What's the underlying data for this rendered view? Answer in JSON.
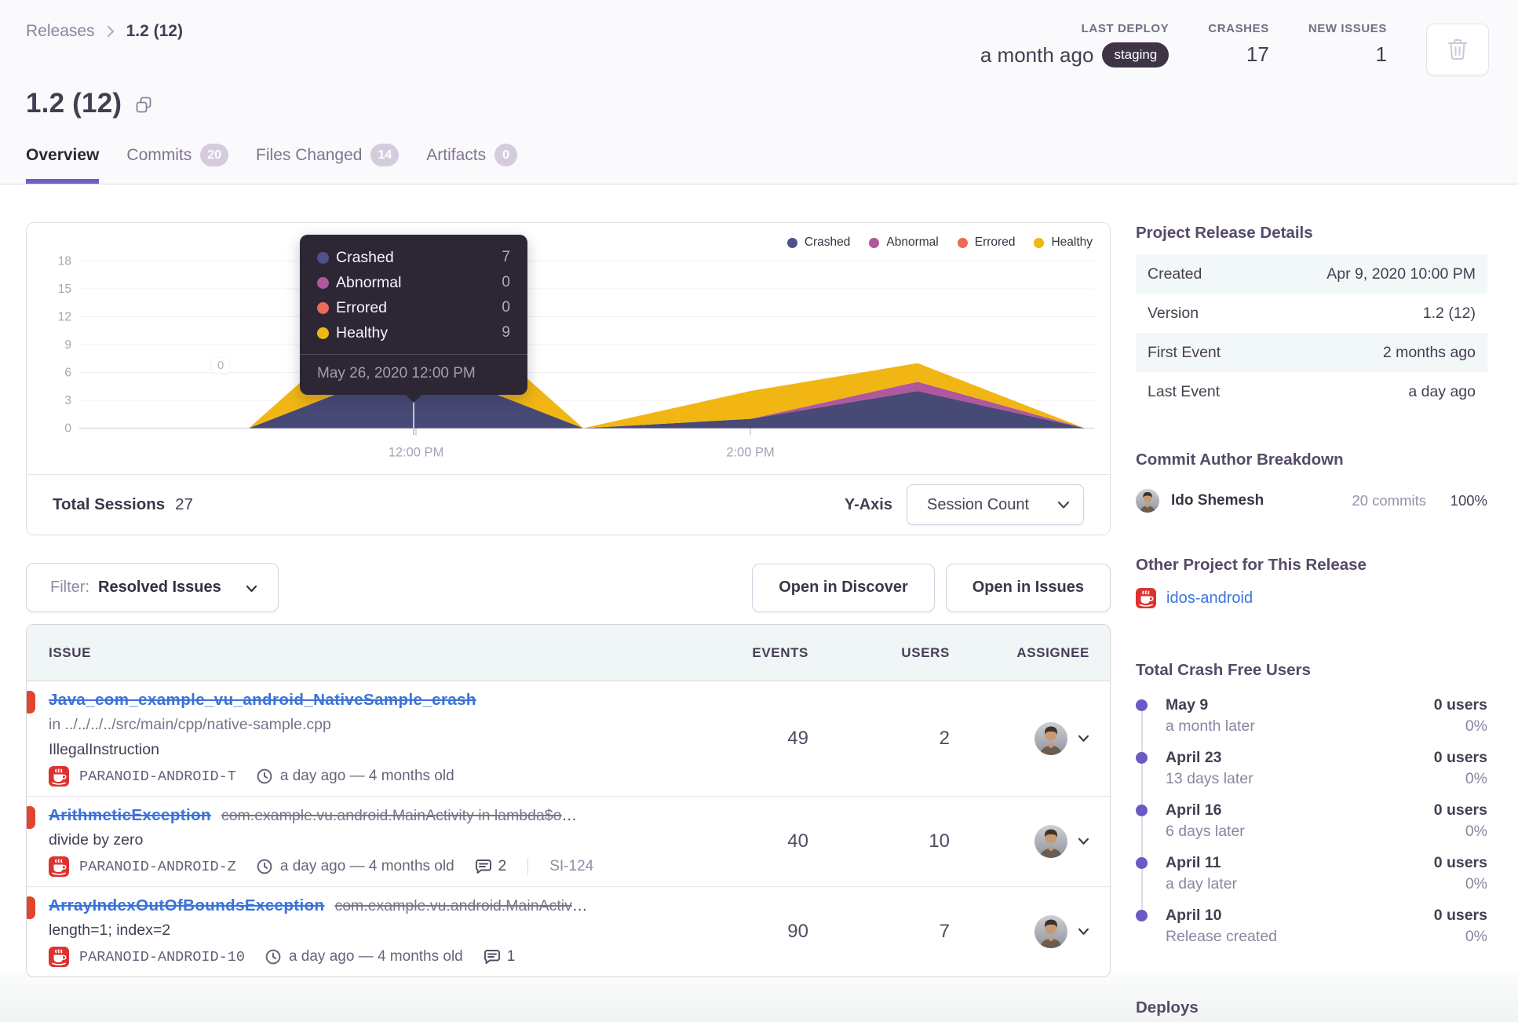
{
  "header": {
    "breadcrumb": {
      "root": "Releases",
      "current": "1.2 (12)"
    },
    "title": "1.2 (12)",
    "stats": [
      {
        "label": "LAST DEPLOY",
        "value": "a month ago",
        "badge": "staging"
      },
      {
        "label": "CRASHES",
        "value": "17"
      },
      {
        "label": "NEW ISSUES",
        "value": "1"
      }
    ],
    "tabs": [
      {
        "label": "Overview",
        "active": true
      },
      {
        "label": "Commits",
        "count": "20"
      },
      {
        "label": "Files Changed",
        "count": "14"
      },
      {
        "label": "Artifacts",
        "count": "0"
      }
    ]
  },
  "chart_data": {
    "type": "area",
    "stacked": true,
    "x": [
      "10:00 AM",
      "11:00 AM",
      "12:00 PM",
      "1:00 PM",
      "2:00 PM",
      "3:00 PM",
      "4:00 PM"
    ],
    "x_tick_labels": [
      {
        "label": "12:00 PM",
        "index": 2
      },
      {
        "label": "2:00 PM",
        "index": 4
      }
    ],
    "series": [
      {
        "name": "Crashed",
        "color": "#474a75",
        "dot_color": "#4f528a",
        "values": [
          0,
          0,
          7,
          0,
          1,
          4,
          0
        ]
      },
      {
        "name": "Abnormal",
        "color": "#b0579d",
        "dot_color": "#b0579d",
        "values": [
          0,
          0,
          0,
          0,
          0,
          1,
          0
        ]
      },
      {
        "name": "Errored",
        "color": "#ec6b58",
        "dot_color": "#ec6b58",
        "values": [
          0,
          0,
          0,
          0,
          0,
          0,
          0
        ]
      },
      {
        "name": "Healthy",
        "color": "#f1b613",
        "dot_color": "#f0b613",
        "values": [
          0,
          0,
          9,
          0,
          3,
          2,
          0
        ]
      }
    ],
    "ylim": [
      0,
      18
    ],
    "y_ticks": [
      0,
      3,
      6,
      9,
      12,
      15,
      18
    ],
    "grid": true,
    "legend_position": "top-right",
    "hover_index": 2,
    "stray_label": "0",
    "tooltip": {
      "timestamp": "May 26, 2020 12:00 PM",
      "rows": [
        {
          "label": "Crashed",
          "value": "7"
        },
        {
          "label": "Abnormal",
          "value": "0"
        },
        {
          "label": "Errored",
          "value": "0"
        },
        {
          "label": "Healthy",
          "value": "9"
        }
      ]
    }
  },
  "chart_footer": {
    "total_sessions_label": "Total Sessions",
    "total_sessions_value": "27",
    "y_axis_label": "Y-Axis",
    "y_axis_value": "Session Count"
  },
  "filter_bar": {
    "filter_label": "Filter:",
    "filter_value": "Resolved Issues",
    "buttons": [
      "Open in Discover",
      "Open in Issues"
    ]
  },
  "issues_table": {
    "columns": [
      "ISSUE",
      "EVENTS",
      "USERS",
      "ASSIGNEE"
    ],
    "rows": [
      {
        "title": "Java_com_example_vu_android_NativeSample_crash",
        "culprit": "",
        "sub_line": "in ../../../../src/main/cpp/native-sample.cpp",
        "message": "IllegalInstruction",
        "short_id": "PARANOID-ANDROID-T",
        "age": "a day ago — 4 months old",
        "comments": "",
        "annotation": "",
        "events": "49",
        "users": "2"
      },
      {
        "title": "ArithmeticException",
        "culprit": "com.example.vu.android.MainActivity in lambda$o…",
        "sub_line": "",
        "message": "divide by zero",
        "short_id": "PARANOID-ANDROID-Z",
        "age": "a day ago — 4 months old",
        "comments": "2",
        "annotation": "SI-124",
        "events": "40",
        "users": "10"
      },
      {
        "title": "ArrayIndexOutOfBoundsException",
        "culprit": "com.example.vu.android.MainActiv…",
        "sub_line": "",
        "message": "length=1; index=2",
        "short_id": "PARANOID-ANDROID-10",
        "age": "a day ago — 4 months old",
        "comments": "1",
        "annotation": "",
        "events": "90",
        "users": "7"
      }
    ]
  },
  "sidebar": {
    "details_heading": "Project Release Details",
    "details": [
      {
        "label": "Created",
        "value": "Apr 9, 2020 10:00 PM"
      },
      {
        "label": "Version",
        "value": "1.2 (12)"
      },
      {
        "label": "First Event",
        "value": "2 months ago"
      },
      {
        "label": "Last Event",
        "value": "a day ago"
      }
    ],
    "author_heading": "Commit Author Breakdown",
    "author": {
      "name": "Ido Shemesh",
      "commits": "20 commits",
      "percent": "100%"
    },
    "other_project_heading": "Other Project for This Release",
    "other_project": "idos-android",
    "crash_free_heading": "Total Crash Free Users",
    "crash_free": [
      {
        "date": "May 9",
        "sub": "a month later",
        "users": "0 users",
        "percent": "0%"
      },
      {
        "date": "April 23",
        "sub": "13 days later",
        "users": "0 users",
        "percent": "0%"
      },
      {
        "date": "April 16",
        "sub": "6 days later",
        "users": "0 users",
        "percent": "0%"
      },
      {
        "date": "April 11",
        "sub": "a day later",
        "users": "0 users",
        "percent": "0%"
      },
      {
        "date": "April 10",
        "sub": "Release created",
        "users": "0 users",
        "percent": "0%"
      }
    ],
    "deploys_heading": "Deploys"
  }
}
